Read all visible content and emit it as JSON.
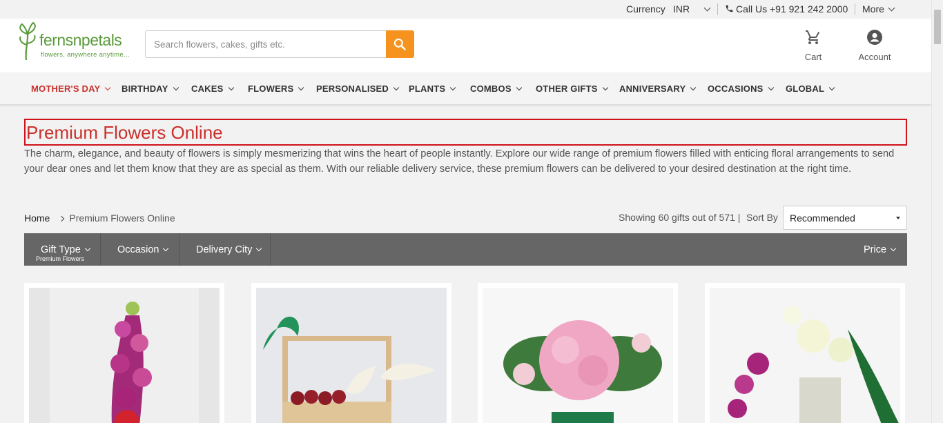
{
  "topbar": {
    "currency_label": "Currency",
    "currency_value": "INR",
    "call_text": "Call Us +91 921 242 2000",
    "more_label": "More"
  },
  "brand": {
    "name": "fernsnpetals",
    "tagline": "flowers, anywhere anytime...",
    "color": "#5a9a3a"
  },
  "search": {
    "placeholder": "Search flowers, cakes, gifts etc."
  },
  "header_actions": {
    "cart_label": "Cart",
    "account_label": "Account"
  },
  "nav": {
    "items": [
      "MOTHER'S DAY",
      "BIRTHDAY",
      "CAKES",
      "FLOWERS",
      "PERSONALISED",
      "PLANTS",
      "COMBOS",
      "OTHER GIFTS",
      "ANNIVERSARY",
      "OCCASIONS",
      "GLOBAL"
    ],
    "active_color": "#c9302c"
  },
  "page": {
    "title": "Premium Flowers Online",
    "description": "The charm, elegance, and beauty of flowers is simply mesmerizing that wins the heart of people instantly. Explore our wide range of premium flowers filled with enticing floral arrangements to send your dear ones and let them know that they are as special as them. With our reliable delivery service, these premium flowers can be delivered to your desired destination at the right time."
  },
  "breadcrumb": {
    "home": "Home",
    "current": "Premium Flowers Online"
  },
  "results": {
    "showing": "Showing 60 gifts out of 571 |",
    "sort_label": "Sort By",
    "sort_value": "Recommended"
  },
  "filters": {
    "gift_type": "Gift Type",
    "gift_type_selected": "Premium Flowers",
    "occasion": "Occasion",
    "delivery_city": "Delivery City",
    "price": "Price"
  },
  "colors": {
    "accent_orange": "#f6931f",
    "filter_bar": "#666666",
    "title_red": "#c9302c"
  }
}
